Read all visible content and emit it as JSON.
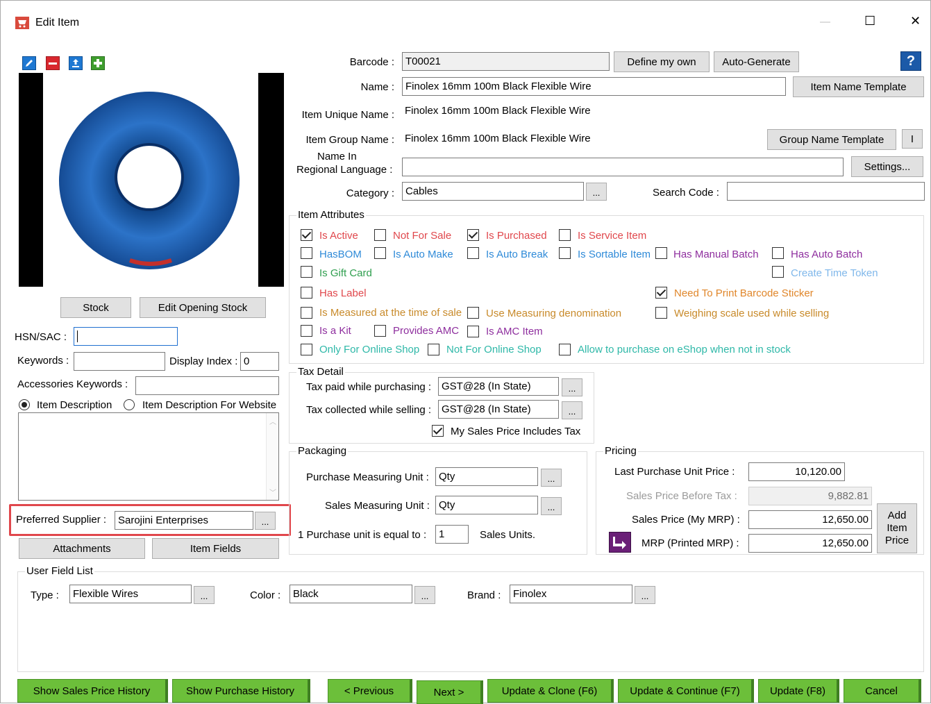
{
  "window": {
    "title": "Edit Item",
    "minimize": "—",
    "maximize": "☐",
    "close": "✕"
  },
  "colors": {
    "green_button": "#6cbf3a",
    "highlight_border": "#e0474c",
    "help_blue": "#1c5aa8"
  },
  "toolbar": {
    "icons": [
      "edit-icon",
      "remove-icon",
      "upload-icon",
      "add-icon"
    ]
  },
  "left": {
    "stock_button": "Stock",
    "edit_opening_stock_button": "Edit Opening Stock",
    "hsn_label": "HSN/SAC :",
    "hsn_value": "",
    "keywords_label": "Keywords :",
    "keywords_value": "",
    "display_index_label": "Display Index :",
    "display_index_value": "0",
    "accessories_label": "Accessories Keywords :",
    "accessories_value": "",
    "radio_desc": "Item Description",
    "radio_desc_web": "Item Description For Website",
    "description_value": "",
    "preferred_supplier_label": "Preferred Supplier :",
    "preferred_supplier_value": "Sarojini Enterprises",
    "attachments_button": "Attachments",
    "item_fields_button": "Item Fields"
  },
  "top": {
    "barcode_label": "Barcode :",
    "barcode_value": "T00021",
    "define_own_button": "Define my own",
    "auto_generate_button": "Auto-Generate",
    "help": "?",
    "name_label": "Name :",
    "name_value": "Finolex 16mm 100m Black Flexible Wire",
    "item_name_template_button": "Item Name Template",
    "unique_name_label": "Item Unique Name :",
    "unique_name_value": "Finolex 16mm 100m Black Flexible Wire",
    "group_name_label": "Item Group Name :",
    "group_name_value": "Finolex 16mm 100m Black Flexible Wire",
    "group_name_template_button": "Group Name Template",
    "info_button": "I",
    "regional_label_1": "Name In",
    "regional_label_2": "Regional Language :",
    "regional_value": "",
    "settings_button": "Settings...",
    "category_label": "Category :",
    "category_value": "Cables",
    "search_code_label": "Search Code :",
    "search_code_value": ""
  },
  "attributes": {
    "title": "Item Attributes",
    "is_active": "Is Active",
    "not_for_sale": "Not For Sale",
    "is_purchased": "Is Purchased",
    "is_service_item": "Is Service Item",
    "has_bom": "HasBOM",
    "is_auto_make": "Is Auto Make",
    "is_auto_break": "Is Auto Break",
    "is_sortable_item": "Is Sortable Item",
    "has_manual_batch": "Has Manual Batch",
    "has_auto_batch": "Has Auto Batch",
    "is_gift_card": "Is Gift Card",
    "create_time_token": "Create Time Token",
    "has_label": "Has Label",
    "need_print_barcode": "Need To Print Barcode Sticker",
    "is_measured": "Is Measured at the time of sale",
    "use_measuring": "Use Measuring denomination",
    "weighing_scale": "Weighing scale used while selling",
    "is_a_kit": "Is a Kit",
    "provides_amc": "Provides AMC",
    "is_amc_item": "Is AMC Item",
    "only_online": "Only For Online Shop",
    "not_online": "Not For Online Shop",
    "allow_purchase_eshop": "Allow to purchase on eShop when not in stock"
  },
  "tax": {
    "title": "Tax Detail",
    "paid_label": "Tax paid while purchasing :",
    "paid_value": "GST@28 (In State)",
    "collected_label": "Tax collected while selling :",
    "collected_value": "GST@28 (In State)",
    "includes_tax": "My Sales Price Includes Tax"
  },
  "packaging": {
    "title": "Packaging",
    "purchase_unit_label": "Purchase Measuring Unit :",
    "purchase_unit_value": "Qty",
    "sales_unit_label": "Sales Measuring Unit :",
    "sales_unit_value": "Qty",
    "equal_label": "1  Purchase unit is equal to :",
    "equal_value": "1",
    "sales_units": "Sales Units."
  },
  "pricing": {
    "title": "Pricing",
    "last_purchase_label": "Last Purchase  Unit Price :",
    "last_purchase_value": "10,120.00",
    "before_tax_label": "Sales Price Before Tax :",
    "before_tax_value": "9,882.81",
    "sales_price_label": "Sales Price (My MRP) :",
    "sales_price_value": "12,650.00",
    "mrp_label": "MRP (Printed MRP) :",
    "mrp_value": "12,650.00",
    "add_item_price_1": "Add",
    "add_item_price_2": "Item",
    "add_item_price_3": "Price"
  },
  "user_fields": {
    "title": "User Field List",
    "type_label": "Type :",
    "type_value": "Flexible Wires",
    "color_label": "Color :",
    "color_value": "Black",
    "brand_label": "Brand :",
    "brand_value": "Finolex"
  },
  "footer": {
    "sales_history": "Show Sales Price History",
    "purchase_history": "Show Purchase History",
    "previous": "< Previous",
    "next": "Next >",
    "update_clone": "Update & Clone (F6)",
    "update_continue": "Update & Continue (F7)",
    "update": "Update (F8)",
    "cancel": "Cancel"
  },
  "dots": "..."
}
